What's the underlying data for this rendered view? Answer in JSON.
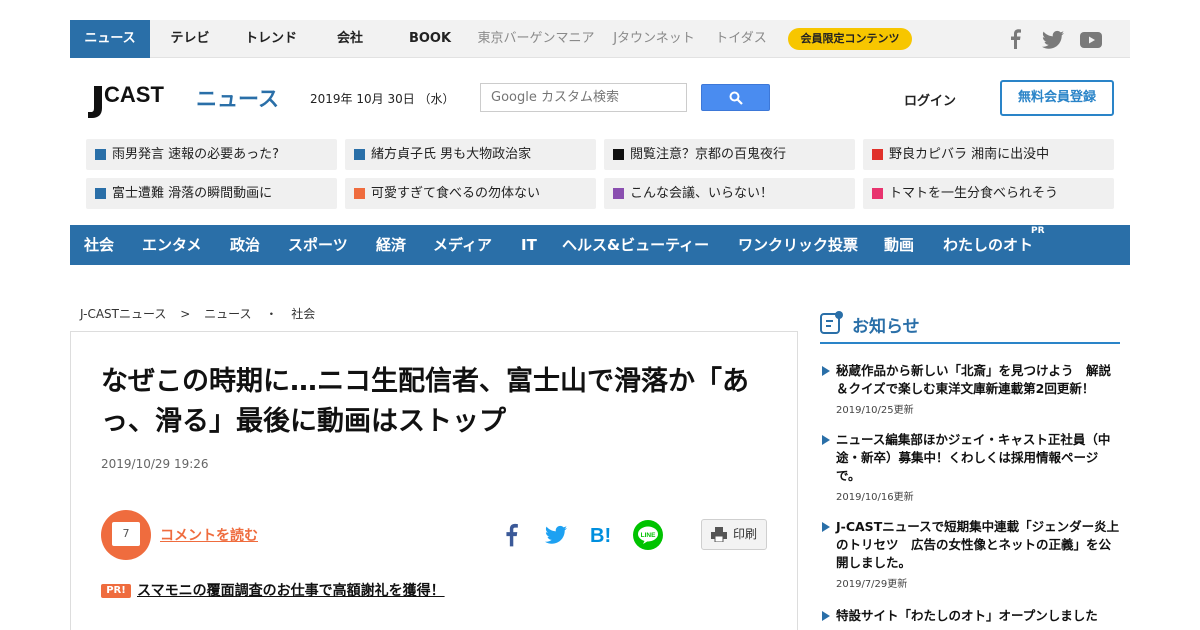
{
  "topnav": {
    "items": [
      "ニュース",
      "テレビ",
      "トレンド",
      "会社",
      "BOOK",
      "東京バーゲンマニア",
      "Jタウンネット",
      "トイダス"
    ],
    "member_badge": "会員限定コンテンツ"
  },
  "header": {
    "logo_text": "J-CAST ニュース",
    "date": "2019年 10月 30日 （水）",
    "search_placeholder": "Google カスタム検索",
    "login": "ログイン",
    "register": "無料会員登録"
  },
  "trending": [
    {
      "label": "雨男発言 速報の必要あった?",
      "color": "#2a6fa8"
    },
    {
      "label": "緒方貞子氏 男も大物政治家",
      "color": "#2a6fa8"
    },
    {
      "label": "閲覧注意？京都の百鬼夜行",
      "color": "#111111"
    },
    {
      "label": "野良カピバラ 湘南に出没中",
      "color": "#e0302a"
    },
    {
      "label": "富士遭難 滑落の瞬間動画に",
      "color": "#2a6fa8"
    },
    {
      "label": "可愛すぎて食べるの勿体ない",
      "color": "#ef6c3e"
    },
    {
      "label": "こんな会議、いらない！",
      "color": "#8a4fb0"
    },
    {
      "label": "トマトを一生分食べられそう",
      "color": "#e8336e"
    }
  ],
  "catnav": {
    "items": [
      "社会",
      "エンタメ",
      "政治",
      "スポーツ",
      "経済",
      "メディア",
      "IT",
      "ヘルス&ビューティー",
      "ワンクリック投票",
      "動画",
      "わたしのオト"
    ],
    "pr": "PR"
  },
  "breadcrumb": [
    "J-CASTニュース",
    ">",
    "ニュース",
    "・",
    "社会"
  ],
  "article": {
    "title": "なぜこの時期に…ニコ生配信者、富士山で滑落か「あっ、滑る」最後に動画はストップ",
    "date": "2019/10/29 19:26",
    "comment_count": "7",
    "comment_link": "コメントを読む",
    "print": "印刷",
    "pr_badge": "PR!",
    "pr_link": "スマモニの覆面調査のお仕事で高額謝礼を獲得！"
  },
  "notices": {
    "title": "お知らせ",
    "items": [
      {
        "text": "秘蔵作品から新しい「北斎」を見つけよう　解説＆クイズで楽しむ東洋文庫新連載第2回更新！",
        "date": "2019/10/25更新"
      },
      {
        "text": "ニュース編集部ほかジェイ・キャスト正社員（中途・新卒）募集中！くわしくは採用情報ページで。",
        "date": "2019/10/16更新"
      },
      {
        "text": "J-CASTニュースで短期集中連載「ジェンダー炎上のトリセツ　広告の女性像とネットの正義」を公開しました。",
        "date": "2019/7/29更新"
      },
      {
        "text": "特設サイト「わたしのオト」オープンしました",
        "date": ""
      }
    ]
  },
  "colors": {
    "brand_blue": "#2a6fa8",
    "accent_orange": "#ef6c3e",
    "badge_yellow": "#f7c600"
  }
}
